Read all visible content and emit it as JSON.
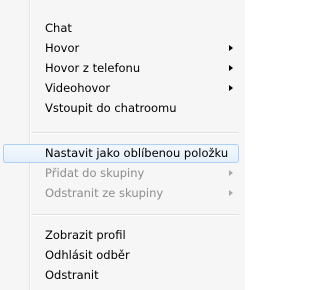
{
  "menu": {
    "items": [
      {
        "label": "Chat"
      },
      {
        "label": "Hovor"
      },
      {
        "label": "Hovor z telefonu"
      },
      {
        "label": "Videohovor"
      },
      {
        "label": "Vstoupit do chatroomu"
      },
      {
        "label": "Nastavit jako oblíbenou položku"
      },
      {
        "label": "Přidat do skupiny"
      },
      {
        "label": "Odstranit ze skupiny"
      },
      {
        "label": "Zobrazit profil"
      },
      {
        "label": "Odhlásit odběr"
      },
      {
        "label": "Odstranit"
      }
    ]
  }
}
